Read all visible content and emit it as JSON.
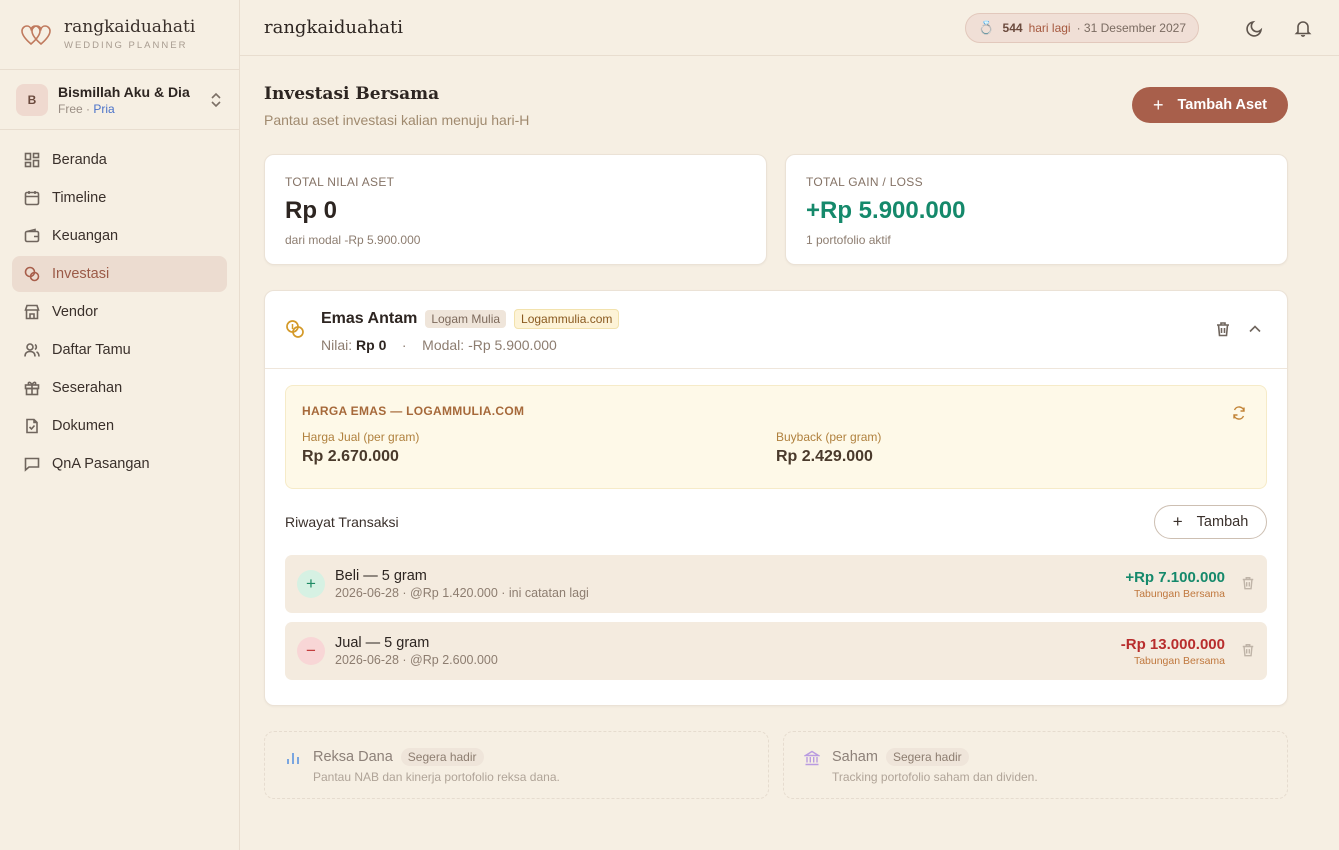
{
  "brand": {
    "name": "rangkaiduahati",
    "subtitle": "WEDDING PLANNER"
  },
  "workspace": {
    "initial": "B",
    "name": "Bismillah Aku & Dia",
    "plan": "Free",
    "separator": "·",
    "role": "Pria"
  },
  "nav": [
    {
      "label": "Beranda",
      "icon": "grid-icon"
    },
    {
      "label": "Timeline",
      "icon": "calendar-icon"
    },
    {
      "label": "Keuangan",
      "icon": "wallet-icon"
    },
    {
      "label": "Investasi",
      "icon": "coins-icon",
      "active": true
    },
    {
      "label": "Vendor",
      "icon": "store-icon"
    },
    {
      "label": "Daftar Tamu",
      "icon": "users-icon"
    },
    {
      "label": "Seserahan",
      "icon": "gift-icon"
    },
    {
      "label": "Dokumen",
      "icon": "document-icon"
    },
    {
      "label": "QnA Pasangan",
      "icon": "chat-icon"
    }
  ],
  "topbar": {
    "title": "rangkaiduahati",
    "countdown": {
      "ring": "💍",
      "days": "544",
      "label": "hari lagi",
      "date": "· 31 Desember 2027"
    }
  },
  "page": {
    "title": "Investasi Bersama",
    "subtitle": "Pantau aset investasi kalian menuju hari-H",
    "add_button": "Tambah Aset"
  },
  "stats": {
    "total_value": {
      "label": "TOTAL NILAI ASET",
      "value": "Rp 0",
      "sub": "dari modal -Rp 5.900.000"
    },
    "total_gain": {
      "label": "TOTAL GAIN / LOSS",
      "value": "+Rp 5.900.000",
      "sub": "1 portofolio aktif"
    }
  },
  "asset": {
    "name": "Emas Antam",
    "tag1": "Logam Mulia",
    "tag2": "Logammulia.com",
    "value_label": "Nilai:",
    "value": "Rp 0",
    "separator": "·",
    "capital": "Modal: -Rp 5.900.000",
    "price": {
      "title": "HARGA EMAS — LOGAMMULIA.COM",
      "sell_label": "Harga Jual (per gram)",
      "sell_value": "Rp 2.670.000",
      "buyback_label": "Buyback (per gram)",
      "buyback_value": "Rp 2.429.000"
    },
    "tx_title": "Riwayat Transaksi",
    "tx_add": "Tambah",
    "transactions": [
      {
        "type": "buy",
        "sign": "+",
        "name": "Beli — 5 gram",
        "meta": "2026-06-28 · @Rp 1.420.000 · ini catatan lagi",
        "amount": "+Rp 7.100.000",
        "source": "Tabungan Bersama"
      },
      {
        "type": "sell",
        "sign": "−",
        "name": "Jual — 5 gram",
        "meta": "2026-06-28 · @Rp 2.600.000",
        "amount": "-Rp 13.000.000",
        "source": "Tabungan Bersama"
      }
    ]
  },
  "coming_soon": [
    {
      "name": "Reksa Dana",
      "tag": "Segera hadir",
      "sub": "Pantau NAB dan kinerja portofolio reksa dana.",
      "icon": "bar-chart-icon"
    },
    {
      "name": "Saham",
      "tag": "Segera hadir",
      "sub": "Tracking portofolio saham dan dividen.",
      "icon": "bank-icon"
    }
  ],
  "colors": {
    "accent": "#a85f4b",
    "gain": "#15896b",
    "loss": "#b82d2d",
    "background": "#f6efe3"
  }
}
